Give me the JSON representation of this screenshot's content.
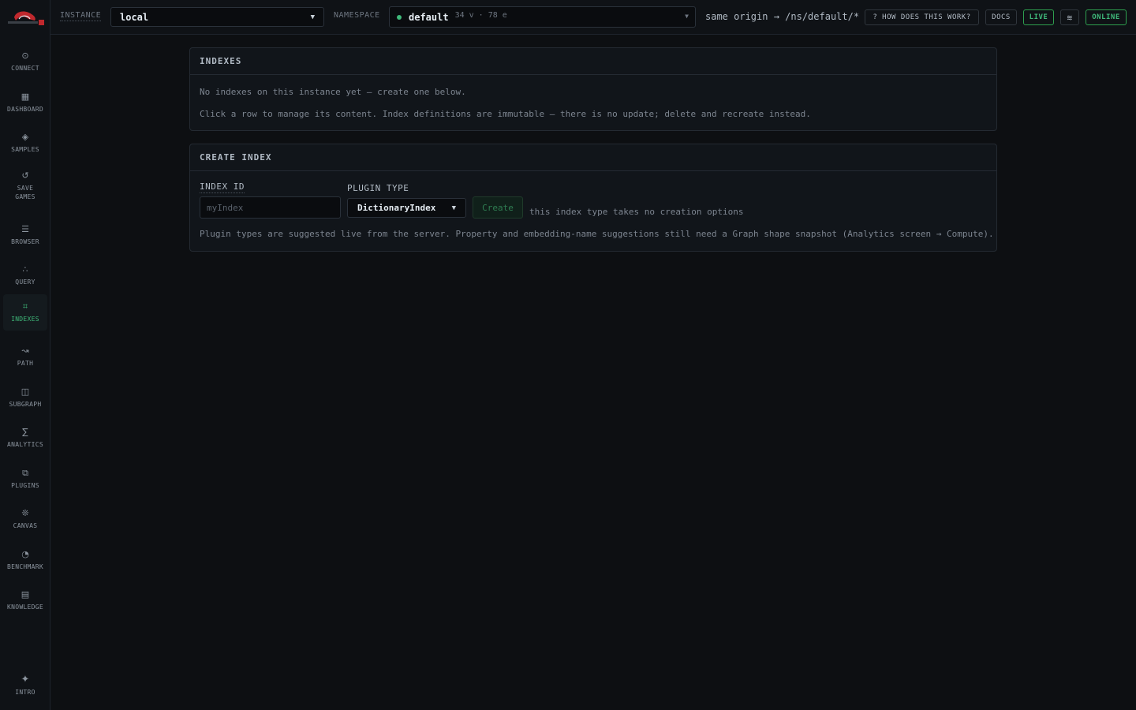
{
  "sidebar": {
    "items": [
      {
        "icon": "⊙",
        "label": "CONNECT"
      },
      {
        "icon": "▦",
        "label": "DASHBOARD"
      },
      {
        "icon": "◈",
        "label": "SAMPLES"
      },
      {
        "icon": "↺",
        "label": "SAVE GAMES"
      },
      {
        "icon": "☰",
        "label": "BROWSER"
      },
      {
        "icon": "∴",
        "label": "QUERY"
      },
      {
        "icon": "⌗",
        "label": "INDEXES"
      },
      {
        "icon": "↝",
        "label": "PATH"
      },
      {
        "icon": "◫",
        "label": "SUBGRAPH"
      },
      {
        "icon": "∑",
        "label": "ANALYTICS"
      },
      {
        "icon": "⧉",
        "label": "PLUGINS"
      },
      {
        "icon": "❊",
        "label": "CANVAS"
      },
      {
        "icon": "◔",
        "label": "BENCHMARK"
      },
      {
        "icon": "▤",
        "label": "KNOWLEDGE"
      }
    ],
    "active": "INDEXES",
    "intro": {
      "icon": "✦",
      "label": "INTRO"
    }
  },
  "topbar": {
    "instance_label": "INSTANCE",
    "instance_value": "local",
    "namespace_label": "NAMESPACE",
    "namespace_value": "default",
    "namespace_stats": "34 v · 78 e",
    "origin": "same origin → /ns/default/*",
    "how_label": "? HOW DOES THIS WORK?",
    "docs_label": "DOCS",
    "live_label": "LIVE",
    "online_label": "ONLINE",
    "accent": "#3fb97a"
  },
  "indexes_panel": {
    "title": "INDEXES",
    "empty_text": "No indexes on this instance yet — create one below.",
    "help_text": "Click a row to manage its content. Index definitions are immutable — there is no update; delete and recreate instead."
  },
  "create_panel": {
    "title": "CREATE INDEX",
    "index_id_label": "INDEX ID",
    "index_id_placeholder": "myIndex",
    "plugin_type_label": "PLUGIN TYPE",
    "plugin_type_value": "DictionaryIndex",
    "create_label": "Create",
    "no_options_text": "this index type takes no creation options",
    "footnote": "Plugin types are suggested live from the server. Property and embedding-name suggestions still need a Graph shape snapshot (Analytics screen → Compute)."
  }
}
